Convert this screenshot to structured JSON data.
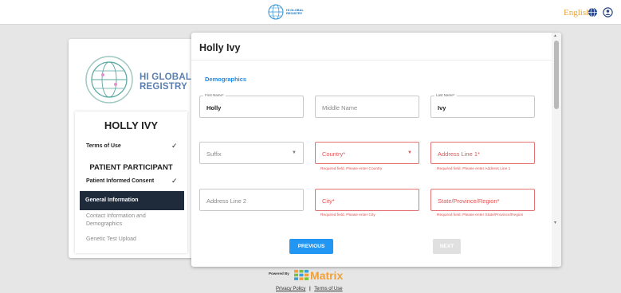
{
  "header": {
    "logo_line1": "HI GLOBAL",
    "logo_line2": "REGISTRY",
    "language": "English",
    "icons": [
      "globe-icon",
      "user-account-icon"
    ]
  },
  "sidebar": {
    "logo_line1": "HI GLOBAL",
    "logo_line2": "REGISTRY",
    "patient_name": "HOLLY IVY",
    "terms_of_use": "Terms of Use",
    "section_heading": "PATIENT PARTICIPANT",
    "informed_consent": "Patient Informed Consent",
    "general_information": "General Information",
    "contact_information": "Contact Information and Demographics",
    "genetic_test_upload": "Genetic Test Upload"
  },
  "form": {
    "title": "Holly Ivy",
    "section": "Demographics",
    "first_name_label": "First Name*",
    "first_name_value": "Holly",
    "middle_name_placeholder": "Middle Name",
    "last_name_label": "Last Name*",
    "last_name_value": "Ivy",
    "suffix_placeholder": "Suffix",
    "country_placeholder": "Country*",
    "country_error": "Required field. Please enter Country",
    "address1_placeholder": "Address Line 1*",
    "address1_error": "Required field. Please enter Address Line 1",
    "address2_placeholder": "Address Line 2",
    "city_placeholder": "City*",
    "city_error": "Required field. Please enter City",
    "state_placeholder": "State/Province/Region*",
    "state_error": "Required field. Please enter State/Province/Region",
    "previous_label": "PREVIOUS",
    "next_label": "NEXT"
  },
  "footer": {
    "powered_by": "Powered By",
    "brand": "Matrix",
    "privacy_policy": "Privacy Policy",
    "separator": "|",
    "terms_of_use": "Terms of Use"
  },
  "colors": {
    "accent": "#2196f3",
    "error": "#e05555",
    "active_step": "#1f2a3a",
    "language": "#e8a23a",
    "brand": "#f2a13a"
  }
}
